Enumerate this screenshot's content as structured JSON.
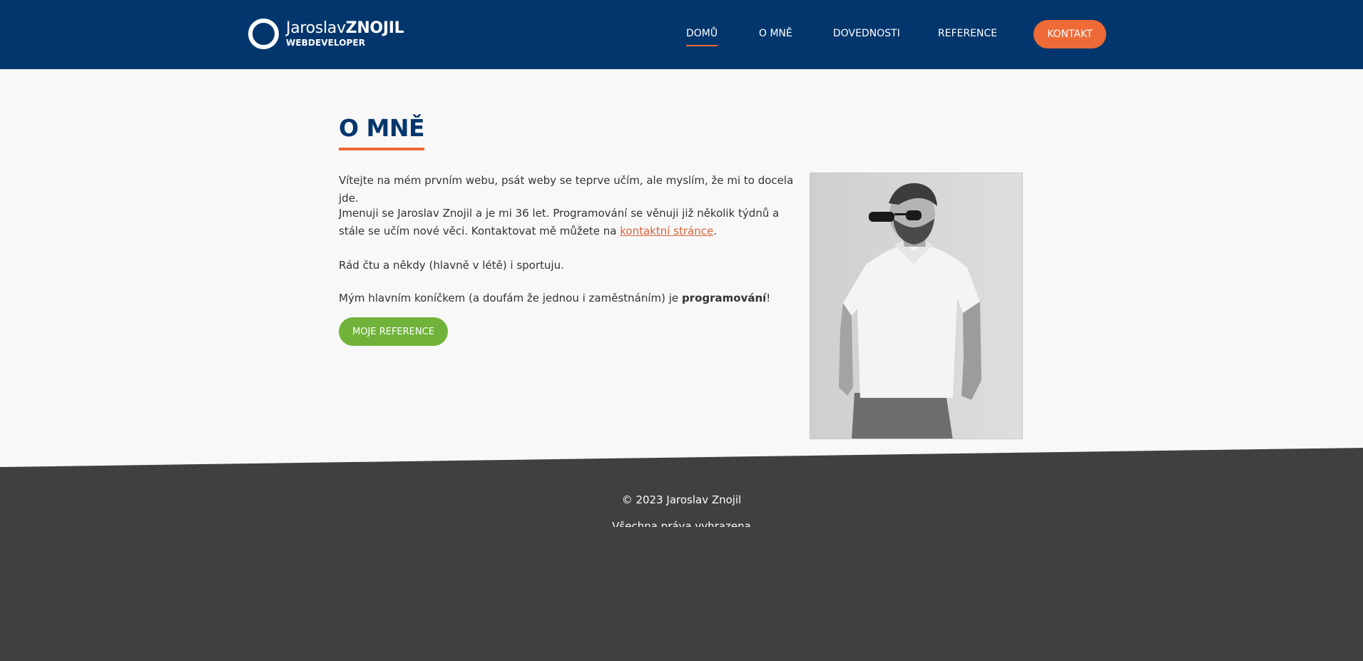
{
  "header": {
    "logo": {
      "first_name": "Jaroslav",
      "last_name": "ZNOJIL",
      "subtitle": "WEBDEVELOPER"
    },
    "nav": [
      {
        "label": "DOMŮ",
        "active": true
      },
      {
        "label": "O MNĚ",
        "active": false
      },
      {
        "label": "DOVEDNOSTI",
        "active": false
      },
      {
        "label": "REFERENCE",
        "active": false
      }
    ],
    "cta_label": "KONTAKT"
  },
  "main": {
    "title": "O MNĚ",
    "p1": "Vítejte na mém prvním webu, psát weby se teprve učím, ale myslím, že mi to docela jde.",
    "p2_text": "Jmenuji se Jaroslav Znojil a je mi 36 let. Programování se věnuji již několik týdnů a stále se učím nové věci. Kontaktovat mě můžete na ",
    "p2_link": "kontaktní stránce",
    "p2_end": ".",
    "p3": "Rád čtu a někdy (hlavně v létě) i sportuju.",
    "p4_text": "Mým hlavním koníčkem (a doufám že jednou i zaměstnáním) je ",
    "p4_bold": "programování",
    "p4_end": "!",
    "button_label": "MOJE REFERENCE"
  },
  "footer": {
    "copyright": "© 2023 Jaroslav Znojil",
    "cut_line": "Všechna práva vyhrazena"
  },
  "colors": {
    "header_bg": "#03366c",
    "accent": "#ee6a37",
    "button_green": "#71b33a",
    "footer_bg": "#404042",
    "page_bg": "#f8f8f8"
  }
}
